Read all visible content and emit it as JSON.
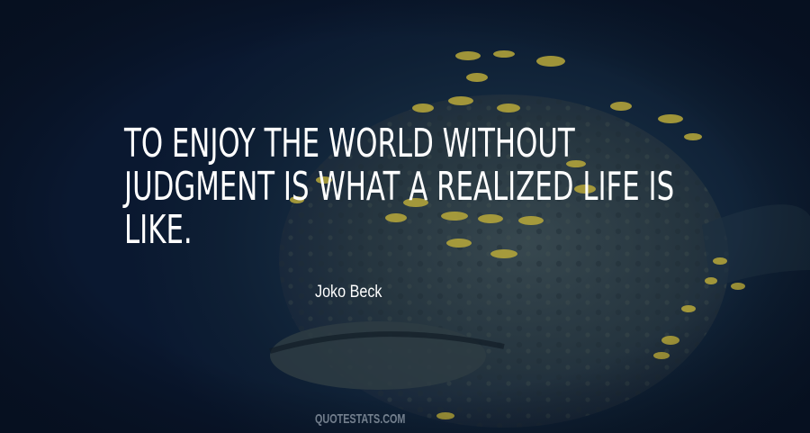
{
  "quote": {
    "lines": [
      "TO ENJOY THE WORLD WITHOUT",
      "JUDGMENT IS WHAT A REALIZED LIFE IS",
      "LIKE."
    ]
  },
  "author": "Joko Beck",
  "watermark": "QUOTESTATS.COM",
  "background": {
    "description_icon": "grouper-fish-underwater-image",
    "colors": {
      "water": "#0c1b2e",
      "fish_body": "#2b3c45",
      "small_fish": "#b9a93a"
    }
  }
}
